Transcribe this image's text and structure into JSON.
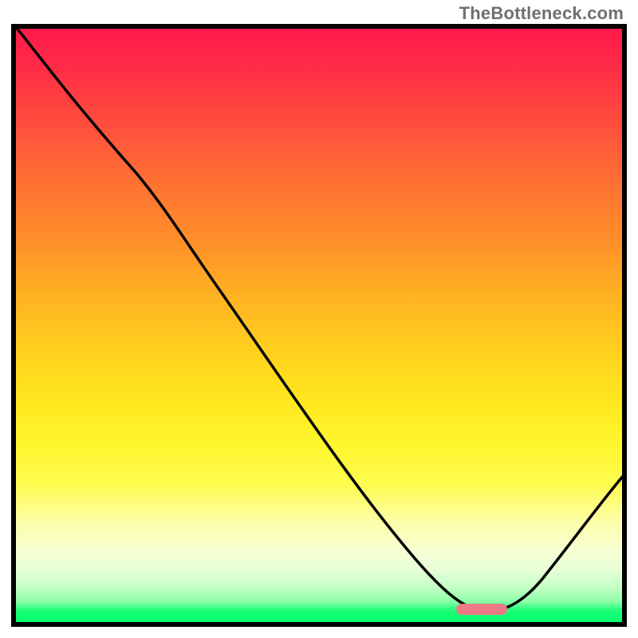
{
  "watermark": "TheBottleneck.com",
  "chart_data": {
    "type": "line",
    "title": "",
    "xlabel": "",
    "ylabel": "",
    "x_range": [
      0,
      100
    ],
    "y_range": [
      0,
      100
    ],
    "series": [
      {
        "name": "curve",
        "x": [
          0,
          5,
          12,
          20,
          28,
          36,
          44,
          52,
          60,
          66,
          72,
          76,
          80,
          86,
          92,
          100
        ],
        "y": [
          100,
          95,
          88,
          80,
          72,
          60,
          48,
          36,
          24,
          14,
          6,
          2,
          1,
          2,
          8,
          20
        ]
      }
    ],
    "marker": {
      "x": 77,
      "y": 1,
      "width_pct": 7
    },
    "gradient_stops": [
      {
        "pct": 0,
        "color": "#ff1a4b"
      },
      {
        "pct": 50,
        "color": "#ffd21e"
      },
      {
        "pct": 90,
        "color": "#f6ffd2"
      },
      {
        "pct": 100,
        "color": "#00ff6a"
      }
    ]
  }
}
